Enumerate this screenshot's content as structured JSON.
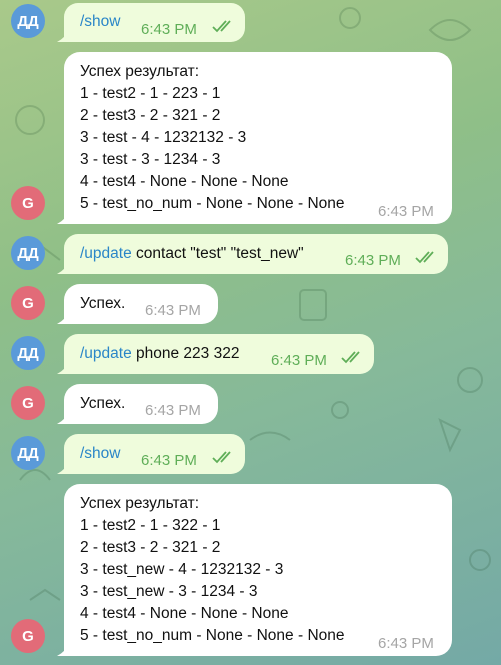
{
  "chat": {
    "messages": [
      {
        "sender": "user",
        "avatar": "ДД",
        "command": "/show",
        "args": "",
        "time": "6:43 PM"
      },
      {
        "sender": "bot",
        "avatar": "G",
        "lines": [
          "Успех результат:",
          "1 - test2 - 1 - 223 - 1",
          "2 - test3 - 2 - 321 - 2",
          "3 - test - 4 - 1232132 - 3",
          "3 - test - 3 - 1234 - 3",
          "4 - test4 - None - None - None",
          "5 - test_no_num - None - None - None"
        ],
        "time": "6:43 PM"
      },
      {
        "sender": "user",
        "avatar": "ДД",
        "command": "/update",
        "args": " contact \"test\" \"test_new\"",
        "time": "6:43 PM"
      },
      {
        "sender": "bot",
        "avatar": "G",
        "lines": [
          "Успех."
        ],
        "time": "6:43 PM"
      },
      {
        "sender": "user",
        "avatar": "ДД",
        "command": "/update",
        "args": " phone 223 322",
        "time": "6:43 PM"
      },
      {
        "sender": "bot",
        "avatar": "G",
        "lines": [
          "Успех."
        ],
        "time": "6:43 PM"
      },
      {
        "sender": "user",
        "avatar": "ДД",
        "command": "/show",
        "args": "",
        "time": "6:43 PM"
      },
      {
        "sender": "bot",
        "avatar": "G",
        "lines": [
          "Успех результат:",
          "1 - test2 - 1 - 322 - 1",
          "2 - test3 - 2 - 321 - 2",
          "3 - test_new - 4 - 1232132 - 3",
          "3 - test_new - 3 - 1234 - 3",
          "4 - test4 - None - None - None",
          "5 - test_no_num - None - None - None"
        ],
        "time": "6:43 PM"
      }
    ]
  },
  "colors": {
    "user_bubble": "#effcdc",
    "bot_bubble": "#ffffff",
    "user_avatar": "#5a9ad9",
    "bot_avatar": "#e26b78",
    "command_link": "#2a86c8",
    "out_time": "#5fae58",
    "in_time": "#a5a5a5"
  }
}
